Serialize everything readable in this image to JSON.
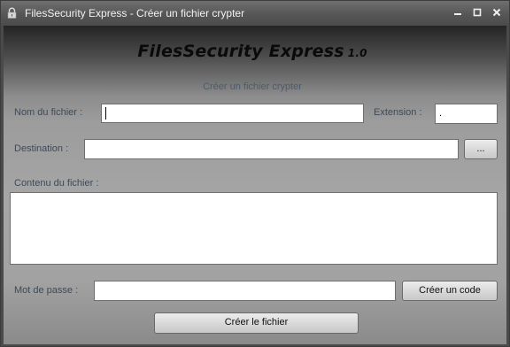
{
  "window": {
    "title": "FilesSecurity Express - Créer un fichier crypter",
    "controls": [
      "minimize",
      "maximize",
      "close"
    ]
  },
  "header": {
    "app_title": "FilesSecurity Express",
    "version": "1.0",
    "subtitle": "Créer un fichier crypter"
  },
  "form": {
    "filename_label": "Nom du fichier :",
    "filename_value": "",
    "extension_label": "Extension :",
    "extension_value": ".",
    "destination_label": "Destination :",
    "destination_value": "",
    "browse_label": "...",
    "content_label": "Contenu du fichier :",
    "content_value": "",
    "password_label": "Mot de passe :",
    "password_value": "",
    "generate_code_label": "Créer un code",
    "create_file_label": "Créer le fichier"
  },
  "icons": {
    "app": "lock-icon",
    "minimize": "minimize-icon",
    "maximize": "maximize-icon",
    "close": "close-icon"
  }
}
